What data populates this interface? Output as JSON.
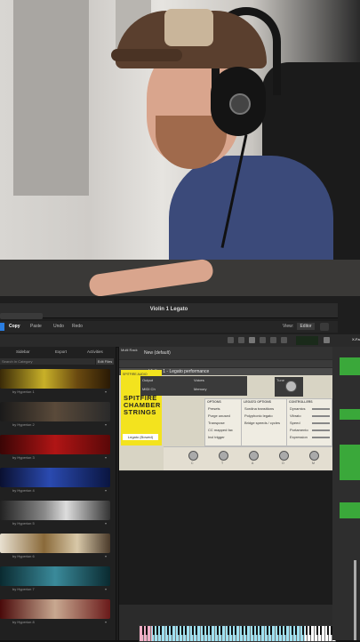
{
  "window": {
    "title": "Violin 1 Legato",
    "toolbar": {
      "copy": "Copy",
      "paste": "Paste",
      "undo": "Undo",
      "redo": "Redo",
      "view_label": "View:",
      "view_value": "Editor"
    },
    "side_label": "X-Fa"
  },
  "browser": {
    "tabs": [
      "Sidebar",
      "Export",
      "Activities",
      "Edit Files"
    ],
    "search_placeholder": "Search In Category",
    "items": [
      {
        "caption": "by Hyperion 1"
      },
      {
        "caption": "by Hyperion 2"
      },
      {
        "caption": "by Hyperion 3"
      },
      {
        "caption": "by Hyperion 4"
      },
      {
        "caption": "by Hyperion 5"
      },
      {
        "caption": "by Hyperion 6"
      },
      {
        "caption": "by Hyperion 7"
      },
      {
        "caption": "by Hyperion 8"
      }
    ]
  },
  "plugin": {
    "multirack": "Multi Rack",
    "preset": "New (default)",
    "instrument_name": "a - Violins 1 - Legato performance",
    "output": "Output",
    "voices": "Voices",
    "midi_ch": "MIDI Ch",
    "memory": "Memory",
    "tile_small": "SPITFIRE AUDIO",
    "tile_title": "SPITFIRE CHAMBER STRINGS",
    "articulation": "Legato (Bowed)",
    "tune_label": "Tune",
    "options_header": "OPTIONS",
    "options": [
      "Presets",
      "Purge unused",
      "Transpose",
      "CC mapped fax",
      "Incl trigger"
    ],
    "legato_header": "LEGATO OPTIONS",
    "legato_options": [
      "Sordina transitions",
      "Polyphonic legato",
      "Bridge speeds / cycles"
    ],
    "controls_header": "CONTROLLERS",
    "controls": [
      "Dynamics",
      "Vibrato",
      "Speed",
      "Portamento",
      "Expression"
    ],
    "mics": [
      "C",
      "T",
      "A",
      "O",
      "M"
    ]
  },
  "colors": {
    "tile_yellow": "#f3e31e",
    "track_green": "#3aa83a",
    "key_blue": "#50c8e6",
    "key_pink": "#e678a0",
    "accent_blue": "#2a7de1"
  }
}
